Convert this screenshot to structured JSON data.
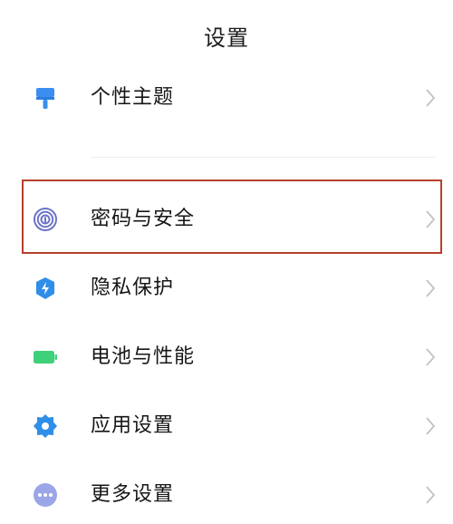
{
  "header": {
    "title": "设置"
  },
  "items": [
    {
      "label": "个性主题",
      "icon": "paint-roller-icon",
      "color": "#3b8ef0"
    },
    {
      "label": "密码与安全",
      "icon": "fingerprint-icon",
      "color": "#6b73c9"
    },
    {
      "label": "隐私保护",
      "icon": "shield-icon",
      "color": "#2f8ee8"
    },
    {
      "label": "电池与性能",
      "icon": "battery-icon",
      "color": "#3fd07a"
    },
    {
      "label": "应用设置",
      "icon": "gear-icon",
      "color": "#2f8ee8"
    },
    {
      "label": "更多设置",
      "icon": "more-dots-icon",
      "color": "#9aa6e8"
    }
  ],
  "highlight_color": "#b5402a",
  "chevron_color": "#c2c2c2"
}
